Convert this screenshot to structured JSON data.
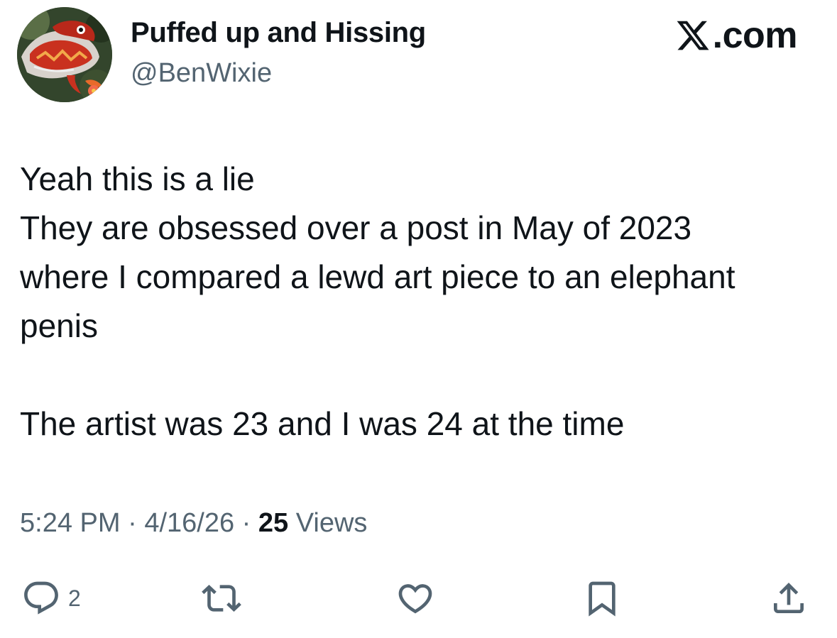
{
  "author": {
    "display_name": "Puffed up and Hissing",
    "handle": "@BenWixie",
    "avatar_icon": "chameleon-avatar"
  },
  "brand": {
    "icon": "x-logo-icon",
    "text": ".com"
  },
  "tweet": {
    "lines": [
      "Yeah this is a lie",
      "They are obsessed over a post in May of 2023",
      "where I compared a lewd art piece to an elephant",
      "penis",
      "",
      "The artist was 23 and I was 24 at the time"
    ]
  },
  "meta": {
    "time": "5:24 PM",
    "separator": " · ",
    "date": "4/16/26",
    "views_count": "25",
    "views_label": " Views"
  },
  "actions": {
    "reply": {
      "icon": "reply-icon",
      "count": "2"
    },
    "repost": {
      "icon": "repost-icon"
    },
    "like": {
      "icon": "heart-icon"
    },
    "bookmark": {
      "icon": "bookmark-icon"
    },
    "share": {
      "icon": "share-icon"
    }
  },
  "colors": {
    "text": "#0f1419",
    "secondary": "#536471",
    "background": "#ffffff"
  }
}
